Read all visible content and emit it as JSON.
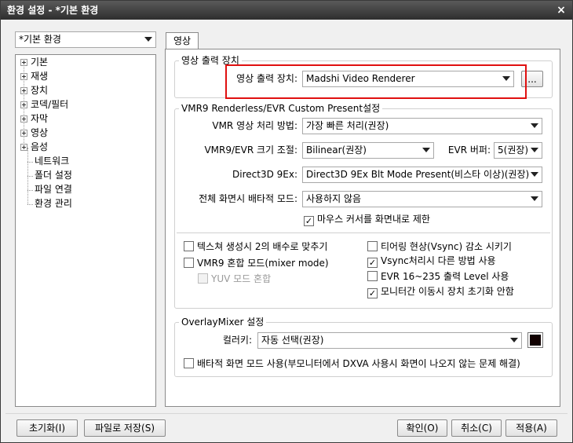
{
  "window": {
    "title": "환경 설정 - *기본 환경",
    "close_icon": "×"
  },
  "profile_select": {
    "value": "*기본 환경"
  },
  "tree": {
    "items": [
      {
        "label": "기본",
        "expandable": true
      },
      {
        "label": "재생",
        "expandable": true
      },
      {
        "label": "장치",
        "expandable": true
      },
      {
        "label": "코덱/필터",
        "expandable": true
      },
      {
        "label": "자막",
        "expandable": true
      },
      {
        "label": "영상",
        "expandable": true
      },
      {
        "label": "음성",
        "expandable": true
      },
      {
        "label": "네트워크",
        "expandable": false
      },
      {
        "label": "폴더 설정",
        "expandable": false
      },
      {
        "label": "파일 연결",
        "expandable": false
      },
      {
        "label": "환경 관리",
        "expandable": false
      }
    ]
  },
  "tab": {
    "label": "영상"
  },
  "output_group": {
    "title": "영상 출력 장치",
    "device_label": "영상 출력 장치:",
    "device_value": "Madshi Video Renderer",
    "browse_label": "..."
  },
  "vmr_group": {
    "title": "VMR9 Renderless/EVR Custom Present설정",
    "method_label": "VMR 영상 처리 방법:",
    "method_value": "가장 빠른 처리(권장)",
    "resize_label": "VMR9/EVR 크기 조절:",
    "resize_value": "Bilinear(권장)",
    "buffer_label": "EVR 버퍼:",
    "buffer_value": "5(권장)",
    "d3d_label": "Direct3D 9Ex:",
    "d3d_value": "Direct3D 9Ex Blt Mode Present(비스타 이상)(권장)",
    "fullscreen_label": "전체 화면시 배타적 모드:",
    "fullscreen_value": "사용하지 않음",
    "mouse_limit_label": "마우스 커서를 화면내로 제한",
    "left_options": [
      {
        "label": "텍스쳐 생성시 2의 배수로 맞추기",
        "checked": false,
        "disabled": false
      },
      {
        "label": "VMR9 혼합 모드(mixer mode)",
        "checked": false,
        "disabled": false
      },
      {
        "label": "YUV 모드 혼합",
        "checked": false,
        "disabled": true
      }
    ],
    "right_options": [
      {
        "label": "티어링 현상(Vsync) 감소 시키기",
        "checked": false
      },
      {
        "label": "Vsync처리시 다른 방법 사용",
        "checked": true
      },
      {
        "label": "EVR 16~235 출력 Level 사용",
        "checked": false
      },
      {
        "label": "모니터간 이동시 장치 초기화 안함",
        "checked": true
      }
    ]
  },
  "overlay_group": {
    "title": "OverlayMixer 설정",
    "colorkey_label": "컬러키:",
    "colorkey_value": "자동 선택(권장)",
    "colorkey_color": "#100000",
    "exclusive_label": "배타적 화면 모드 사용(부모니터에서 DXVA 사용시 화면이 나오지 않는 문제 해결)"
  },
  "footer": {
    "reset_label": "초기화(I)",
    "save_label": "파일로 저장(S)",
    "ok_label": "확인(O)",
    "cancel_label": "취소(C)",
    "apply_label": "적용(A)"
  },
  "colors": {
    "highlight": "#e01010",
    "titlebar": "#3a3a3a"
  }
}
